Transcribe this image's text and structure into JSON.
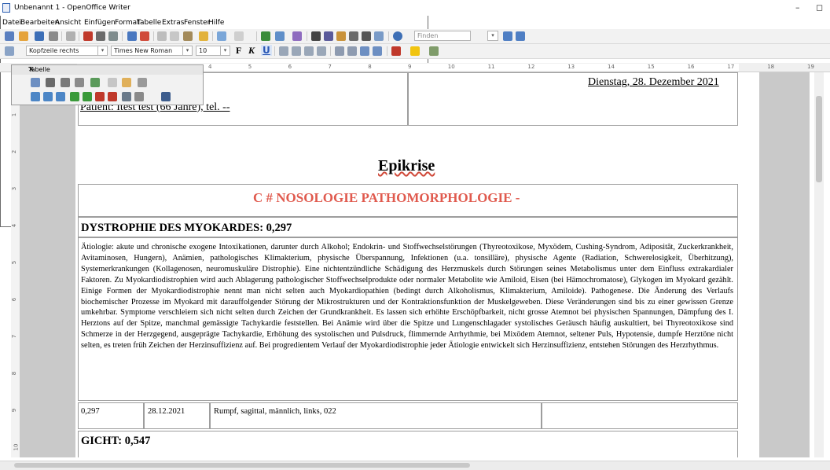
{
  "window": {
    "title": "Unbenannt 1 - OpenOffice Writer",
    "minimize": "–",
    "restore": "◻"
  },
  "menu": [
    "Datei",
    "Bearbeiten",
    "Ansicht",
    "Einfügen",
    "Format",
    "Tabelle",
    "Extras",
    "Fenster",
    "Hilfe"
  ],
  "toolbar": {
    "search_placeholder": "Finden",
    "paragraph_style": "Kopfzeile rechts",
    "font_name": "Times New Roman",
    "font_size": "10",
    "bold": "F",
    "italic": "K",
    "underline": "U"
  },
  "ruler": {
    "labels": [
      "4",
      "5",
      "6",
      "7",
      "8",
      "9",
      "10",
      "11",
      "12",
      "13",
      "14",
      "15",
      "16",
      "17",
      "18",
      "19"
    ],
    "left_labels": [
      "1",
      "2",
      "3",
      "4",
      "5",
      "6",
      "7",
      "8",
      "9",
      "10"
    ]
  },
  "table_panel": {
    "title": "Tabelle",
    "close": "✕"
  },
  "document": {
    "date": "Dienstag, 28. Dezember 2021",
    "patient": "Patient: Itest test (66 Jahre), tel. --",
    "heading": "Epikrise",
    "section_title": "C # NOSOLOGIE PATHOMORPHOLOGIE -",
    "diagnosis1": "DYSTROPHIE DES MYOKARDES: 0,297",
    "paragraph": "Ätiologie: akute und chronische exogene Intoxikationen, darunter durch Alkohol; Endokrin- und Stoffwechselstörungen (Thyreotoxikose, Myxödem, Cushing-Syndrom, Adipositãt, Zuckerkrankheit, Avitaminosen, Hungern), Anämien, pathologisches Klimakterium, physische Überspannung, Infektionen (u.a. tonsilläre), physische Agente (Radiation, Schwerelosigkeit, Überhitzung), Systemerkrankungen (Kollagenosen, neuromuskuläre Distrophie). Eine nichtentzündliche Schädigung des Herzmuskels durch Störungen seines Metabolismus unter dem Einfluss extrakardialer Faktoren. Zu Myokardiodistrophien wird auch Ablagerung pathologischer Stoffwechselprodukte oder normaler Metabolite wie Amiloid, Eisen (bei Hämochromatose), Glykogen im Myokard gezählt. Einige Formen der Myokardiodistrophie nennt man nicht selten auch Myokardiopathien (bedingt durch Alkoholismus, Klimakterium, Amiloide). Pathogenese. Die Änderung des Verlaufs biochemischer Prozesse im Myokard mit darauffolgender Störung der Mikrostrukturen und der Kontraktionsfunktion der Muskelgeweben. Diese Veränderungen sind bis zu einer gewissen Grenze umkehrbar. Symptome verschleiern sich nicht selten durch Zeichen der Grundkrankheit. Es lassen sich erhöhte Erschöpfbarkeit, nicht grosse Atemnot bei physischen Spannungen, Dämpfung des I. Herztons auf der Spitze, manchmal gemässigte Tachykardie feststellen. Bei Anämie wird über die Spitze und Lungenschlagader systolisches Geräusch häufig auskultiert, bei Thyreotoxikose sind Schmerze in der Herzgegend, ausgeprägte Tachykardie, Erhöhung des systolischen und Pulsdruck, flimmernde Arrhythmie, bei Mixödem Atemnot, seltener Puls, Hypotensie, dumpfe Herztöne nicht selten, es treten früh Zeichen der Herzinsuffizienz auf. Bei progredientem Verlauf der Myokardiodistrophie jeder Ätiologie entwickelt sich Herzinsuffizienz, entstehen Störungen des Herzrhythmus.",
    "row": {
      "value": "0,297",
      "date": "28.12.2021",
      "location": "Rumpf, sagittal, männlich, links, 022"
    },
    "diagnosis2": "GICHT: 0,547"
  },
  "colors": {
    "accent_red": "#e05a4e",
    "toolbar_bg": "#f2f2f2",
    "workspace_bg": "#c9c9c9"
  }
}
